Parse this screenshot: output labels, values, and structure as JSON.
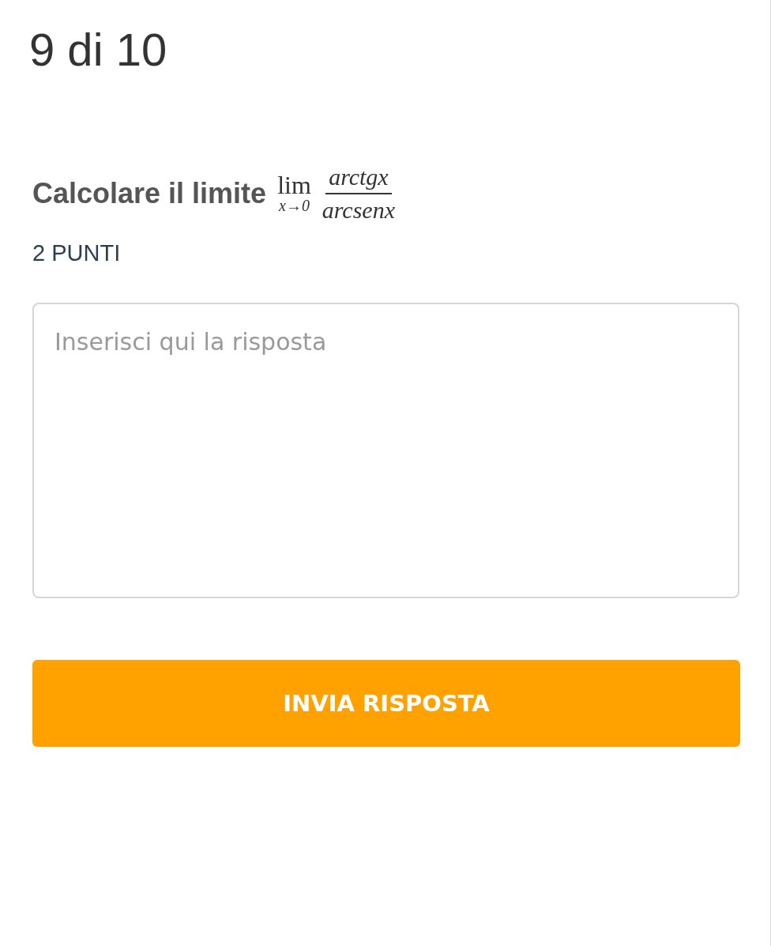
{
  "progress": "9 di 10",
  "question": {
    "text": "Calcolare il limite",
    "math": {
      "operator": "lim",
      "subscript": "x→0",
      "numerator": "arctgx",
      "denominator": "arcsenx"
    }
  },
  "points": "2 PUNTI",
  "answer": {
    "placeholder": "Inserisci qui la risposta"
  },
  "submit_button": "INVIA RISPOSTA"
}
